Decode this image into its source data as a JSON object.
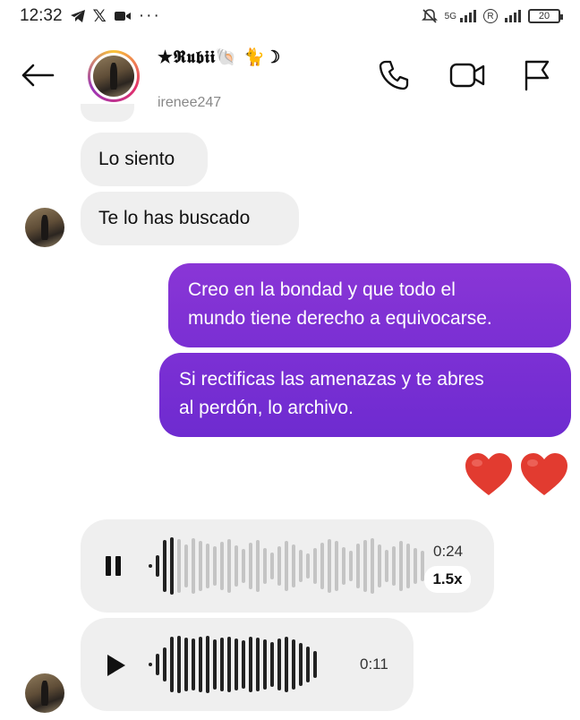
{
  "status_bar": {
    "time": "12:32",
    "network_label": "5G",
    "roaming_label": "R",
    "battery": "20"
  },
  "header": {
    "contact_name": "★𝕽𝖚𝖇𝖎𝖎🐚 🐈☽",
    "username": "irenee247"
  },
  "messages": {
    "in_1": "Lo siento",
    "in_2": "Te lo has buscado",
    "out_1_line1": "Creo en la bondad y que todo el",
    "out_1_line2": "mundo tiene derecho a equivocarse.",
    "out_2_line1": "Si rectificas las amenazas y te abres",
    "out_2_line2": "al perdón, lo archivo.",
    "hearts": "❤️❤️"
  },
  "voice_1": {
    "duration": "0:24",
    "speed": "1.5x",
    "state": "playing",
    "progress": 0.08
  },
  "voice_2": {
    "duration": "0:11",
    "state": "paused"
  },
  "colors": {
    "outgoing_bubble": "#7a2fd3",
    "incoming_bubble": "#efefef"
  },
  "icons": {
    "back": "arrow-left-icon",
    "call": "phone-icon",
    "video": "video-camera-icon",
    "report": "flag-icon",
    "pause": "pause-icon",
    "play": "play-icon"
  }
}
